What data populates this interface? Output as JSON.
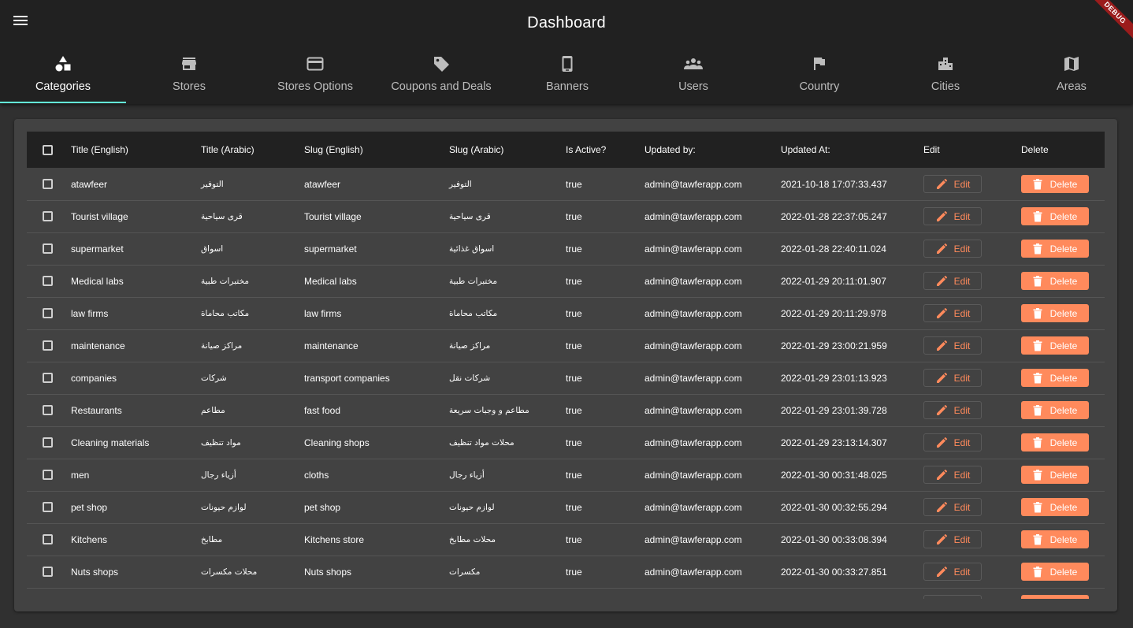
{
  "app": {
    "title": "Dashboard",
    "debug_label": "DEBUG"
  },
  "tabs": [
    {
      "label": "Categories",
      "icon": "category-icon",
      "active": true
    },
    {
      "label": "Stores",
      "icon": "store-icon"
    },
    {
      "label": "Stores Options",
      "icon": "credit-card-icon"
    },
    {
      "label": "Coupons and Deals",
      "icon": "tag-icon"
    },
    {
      "label": "Banners",
      "icon": "phone-icon"
    },
    {
      "label": "Users",
      "icon": "people-icon"
    },
    {
      "label": "Country",
      "icon": "flag-icon"
    },
    {
      "label": "Cities",
      "icon": "city-icon"
    },
    {
      "label": "Areas",
      "icon": "map-icon"
    }
  ],
  "table": {
    "headers": {
      "title_en": "Title (English)",
      "title_ar": "Title (Arabic)",
      "slug_en": "Slug (English)",
      "slug_ar": "Slug (Arabic)",
      "is_active": "Is Active?",
      "updated_by": "Updated by:",
      "updated_at": "Updated At:",
      "edit": "Edit",
      "delete": "Delete"
    },
    "edit_label": "Edit",
    "delete_label": "Delete",
    "rows": [
      {
        "title_en": "atawfeer",
        "title_ar": "التوفير",
        "slug_en": "atawfeer",
        "slug_ar": "التوفير",
        "is_active": "true",
        "updated_by": "admin@tawferapp.com",
        "updated_at": "2021-10-18 17:07:33.437"
      },
      {
        "title_en": "Tourist village",
        "title_ar": "قرى سياحية",
        "slug_en": "Tourist village",
        "slug_ar": "قرى سياحية",
        "is_active": "true",
        "updated_by": "admin@tawferapp.com",
        "updated_at": "2022-01-28 22:37:05.247"
      },
      {
        "title_en": "supermarket",
        "title_ar": "اسواق",
        "slug_en": "supermarket",
        "slug_ar": "اسواق غذائية",
        "is_active": "true",
        "updated_by": "admin@tawferapp.com",
        "updated_at": "2022-01-28 22:40:11.024"
      },
      {
        "title_en": " Medical labs",
        "title_ar": "مختبرات طبية",
        "slug_en": " Medical labs",
        "slug_ar": "مختبرات طبية",
        "is_active": "true",
        "updated_by": "admin@tawferapp.com",
        "updated_at": "2022-01-29 20:11:01.907"
      },
      {
        "title_en": "law firms",
        "title_ar": "مكاتب محاماة",
        "slug_en": "law firms",
        "slug_ar": "مكاتب محاماة",
        "is_active": "true",
        "updated_by": "admin@tawferapp.com",
        "updated_at": "2022-01-29 20:11:29.978"
      },
      {
        "title_en": "maintenance",
        "title_ar": "مراكز صيانة",
        "slug_en": "maintenance",
        "slug_ar": "مراكز صيانة",
        "is_active": "true",
        "updated_by": "admin@tawferapp.com",
        "updated_at": "2022-01-29 23:00:21.959"
      },
      {
        "title_en": "companies",
        "title_ar": "شركات",
        "slug_en": "transport companies",
        "slug_ar": "شركات نقل",
        "is_active": "true",
        "updated_by": "admin@tawferapp.com",
        "updated_at": "2022-01-29 23:01:13.923"
      },
      {
        "title_en": "Restaurants",
        "title_ar": "مطاعم",
        "slug_en": "fast food",
        "slug_ar": "مطاعم و وجبات سريعة",
        "is_active": "true",
        "updated_by": "admin@tawferapp.com",
        "updated_at": "2022-01-29 23:01:39.728"
      },
      {
        "title_en": "Cleaning materials",
        "title_ar": "مواد تنظيف",
        "slug_en": "Cleaning shops",
        "slug_ar": "محلات مواد تنظيف",
        "is_active": "true",
        "updated_by": "admin@tawferapp.com",
        "updated_at": "2022-01-29 23:13:14.307"
      },
      {
        "title_en": "men",
        "title_ar": "أزياء رجال",
        "slug_en": "cloths",
        "slug_ar": "أزياء رجال",
        "is_active": "true",
        "updated_by": "admin@tawferapp.com",
        "updated_at": "2022-01-30 00:31:48.025"
      },
      {
        "title_en": "pet shop",
        "title_ar": "لوازم حيونات",
        "slug_en": "pet shop",
        "slug_ar": "لوازم حيونات",
        "is_active": "true",
        "updated_by": "admin@tawferapp.com",
        "updated_at": "2022-01-30 00:32:55.294"
      },
      {
        "title_en": "Kitchens",
        "title_ar": "مطابخ",
        "slug_en": "Kitchens store",
        "slug_ar": "محلات مطابخ",
        "is_active": "true",
        "updated_by": "admin@tawferapp.com",
        "updated_at": "2022-01-30 00:33:08.394"
      },
      {
        "title_en": "Nuts shops",
        "title_ar": "محلات مكسرات",
        "slug_en": "Nuts shops",
        "slug_ar": "مكسرات",
        "is_active": "true",
        "updated_by": "admin@tawferapp.com",
        "updated_at": "2022-01-30 00:33:27.851"
      }
    ]
  }
}
